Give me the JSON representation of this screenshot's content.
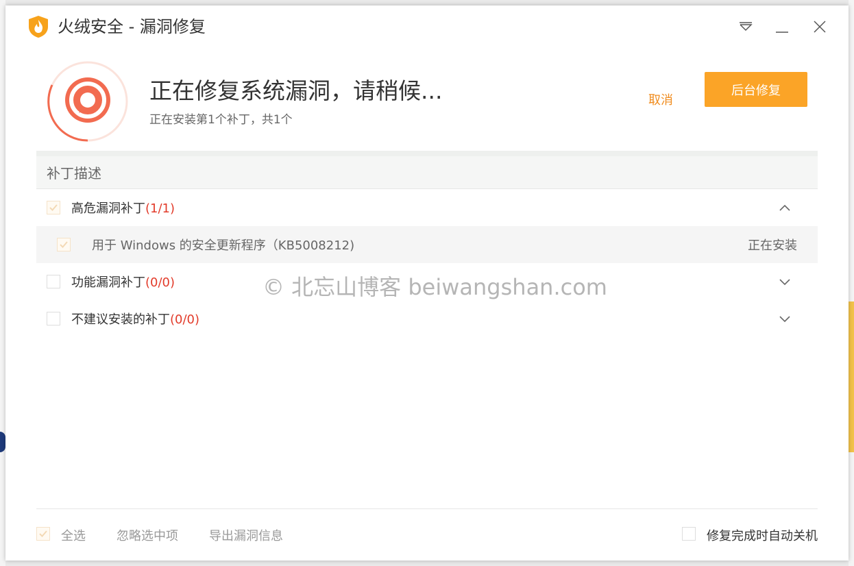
{
  "window": {
    "title": "火绒安全 - 漏洞修复"
  },
  "header": {
    "headline": "正在修复系统漏洞，请稍候...",
    "subline": "正在安装第1个补丁，共1个",
    "cancel_label": "取消",
    "background_repair_label": "后台修复"
  },
  "list": {
    "column_header": "补丁描述",
    "groups": [
      {
        "label": "高危漏洞补丁",
        "count": "(1/1)",
        "checked": true,
        "expanded": true
      },
      {
        "label": "功能漏洞补丁",
        "count": "(0/0)",
        "checked": false,
        "expanded": false
      },
      {
        "label": "不建议安装的补丁",
        "count": "(0/0)",
        "checked": false,
        "expanded": false
      }
    ],
    "items": [
      {
        "label": "用于 Windows 的安全更新程序（KB5008212)",
        "status": "正在安装",
        "checked": true
      }
    ]
  },
  "watermark": "© 北忘山博客 beiwangshan.com",
  "footer": {
    "select_all": "全选",
    "ignore_selected": "忽略选中项",
    "export_info": "导出漏洞信息",
    "auto_shutdown": "修复完成时自动关机"
  },
  "colors": {
    "accent": "#fba427",
    "link": "#f08c1e",
    "count_red": "#e23b2a",
    "ring": "#f26b50"
  }
}
